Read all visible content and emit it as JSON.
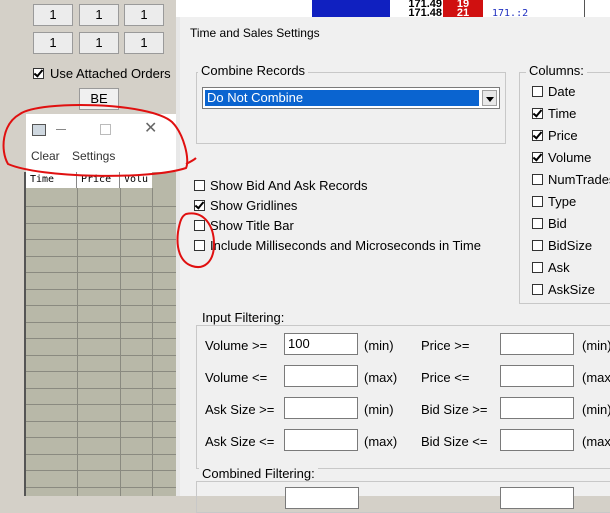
{
  "left_panel": {
    "numbers": [
      "1",
      "1",
      "1",
      "1",
      "1",
      "1"
    ],
    "use_attached_orders": {
      "label": "Use Attached Orders",
      "checked": true
    },
    "be_label": "BE"
  },
  "mini_window": {
    "menu": [
      "Clear",
      "Settings"
    ],
    "columns": [
      "Time",
      "Price",
      "Volu"
    ]
  },
  "top_strip": {
    "prices": [
      "171.49",
      "171.48"
    ],
    "volumes": [
      "19",
      "21"
    ],
    "right_value": "171.:2"
  },
  "dialog": {
    "title": "Time and Sales Settings",
    "combine": {
      "label": "Combine Records",
      "value": "Do Not Combine"
    },
    "columns_label": "Columns:",
    "columns": [
      {
        "label": "Date",
        "checked": false
      },
      {
        "label": "Time",
        "checked": true
      },
      {
        "label": "Price",
        "checked": true
      },
      {
        "label": "Volume",
        "checked": true
      },
      {
        "label": "NumTrades",
        "checked": false
      },
      {
        "label": "Type",
        "checked": false
      },
      {
        "label": "Bid",
        "checked": false
      },
      {
        "label": "BidSize",
        "checked": false
      },
      {
        "label": "Ask",
        "checked": false
      },
      {
        "label": "AskSize",
        "checked": false
      }
    ],
    "options": [
      {
        "label": "Show Bid And Ask Records",
        "checked": false
      },
      {
        "label": "Show Gridlines",
        "checked": true
      },
      {
        "label": "Show Title Bar",
        "checked": false
      },
      {
        "label": "Include Milliseconds and Microseconds in Time",
        "checked": false
      }
    ],
    "input_filtering": {
      "label": "Input Filtering:",
      "rows": [
        {
          "left": "Volume >=",
          "left_value": "100",
          "left_unit": "(min)",
          "right": "Price >=",
          "right_value": "",
          "right_unit": "(min)"
        },
        {
          "left": "Volume <=",
          "left_value": "",
          "left_unit": "(max)",
          "right": "Price <=",
          "right_value": "",
          "right_unit": "(max)"
        },
        {
          "left": "Ask Size >=",
          "left_value": "",
          "left_unit": "(min)",
          "right": "Bid Size >=",
          "right_value": "",
          "right_unit": "(min)"
        },
        {
          "left": "Ask Size <=",
          "left_value": "",
          "left_unit": "(max)",
          "right": "Bid Size <=",
          "right_value": "",
          "right_unit": "(max)"
        }
      ]
    },
    "combined_filtering": {
      "label": "Combined Filtering:"
    }
  },
  "colors": {
    "selection": "#0a64d0",
    "annotation": "#e01010",
    "bid_red": "#d01010",
    "ask_blue": "#1020c0"
  }
}
